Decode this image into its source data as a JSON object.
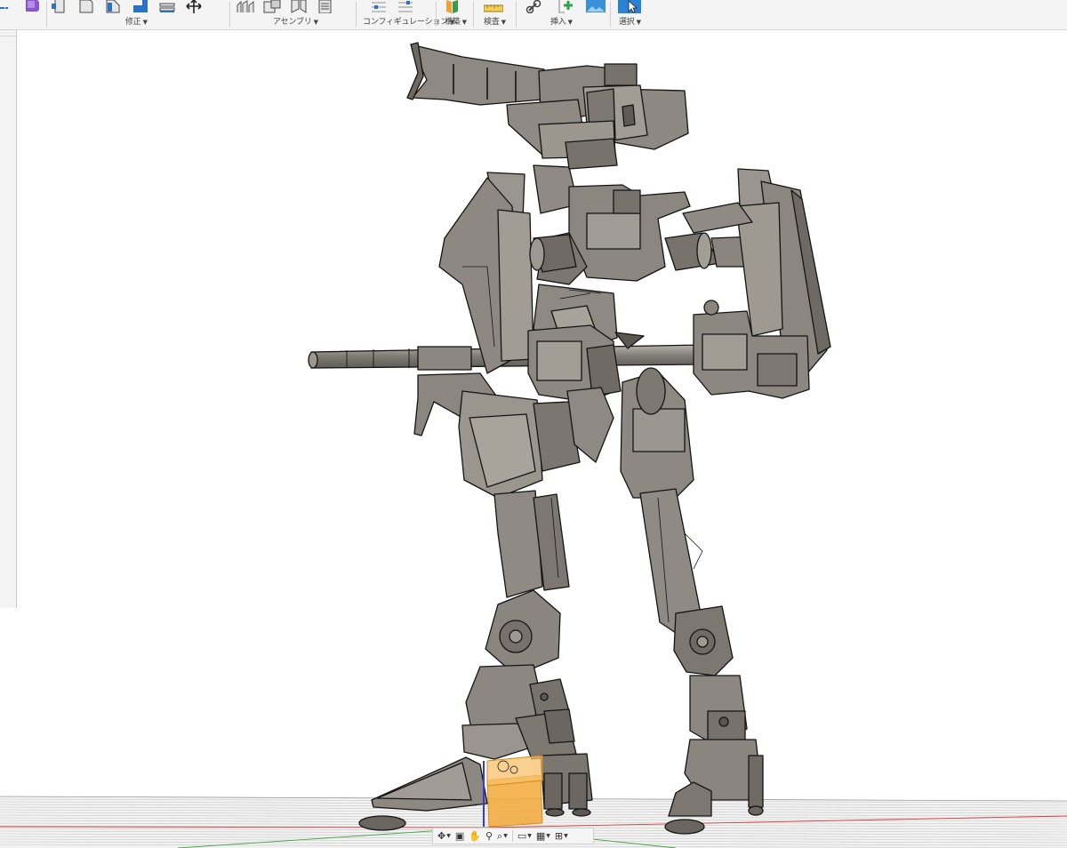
{
  "toolbar": {
    "groups": [
      {
        "id": "modify",
        "label": "修正",
        "has_menu": true
      },
      {
        "id": "assemble",
        "label": "アセンブリ",
        "has_menu": true
      },
      {
        "id": "configure",
        "label": "コンフィギュレーション",
        "has_menu": true
      },
      {
        "id": "construct",
        "label": "構築",
        "has_menu": true
      },
      {
        "id": "inspect",
        "label": "検査",
        "has_menu": true
      },
      {
        "id": "insert",
        "label": "挿入",
        "has_menu": true
      },
      {
        "id": "select",
        "label": "選択",
        "has_menu": true
      }
    ]
  },
  "viewport": {
    "model": "robot-mech-3d-model",
    "colors": {
      "model_fill": "#8b867f",
      "model_dark": "#5e5a54",
      "outline": "#141414",
      "highlight": "#f3a93a",
      "axis_blue": "#3838d8",
      "ground_line": "#d23b3b",
      "ground_green": "#3da33d"
    }
  },
  "navbar": {
    "buttons": [
      {
        "id": "orbit",
        "icon": "orbit-icon",
        "has_menu": true
      },
      {
        "id": "look-at",
        "icon": "look-at-icon",
        "has_menu": false
      },
      {
        "id": "pan",
        "icon": "pan-hand-icon",
        "has_menu": false
      },
      {
        "id": "zoom",
        "icon": "zoom-icon",
        "has_menu": false
      },
      {
        "id": "fit",
        "icon": "zoom-fit-icon",
        "has_menu": true
      },
      {
        "id": "display",
        "icon": "display-settings-icon",
        "has_menu": true
      },
      {
        "id": "grid",
        "icon": "grid-icon",
        "has_menu": true
      },
      {
        "id": "viewports",
        "icon": "viewports-icon",
        "has_menu": true
      }
    ]
  }
}
